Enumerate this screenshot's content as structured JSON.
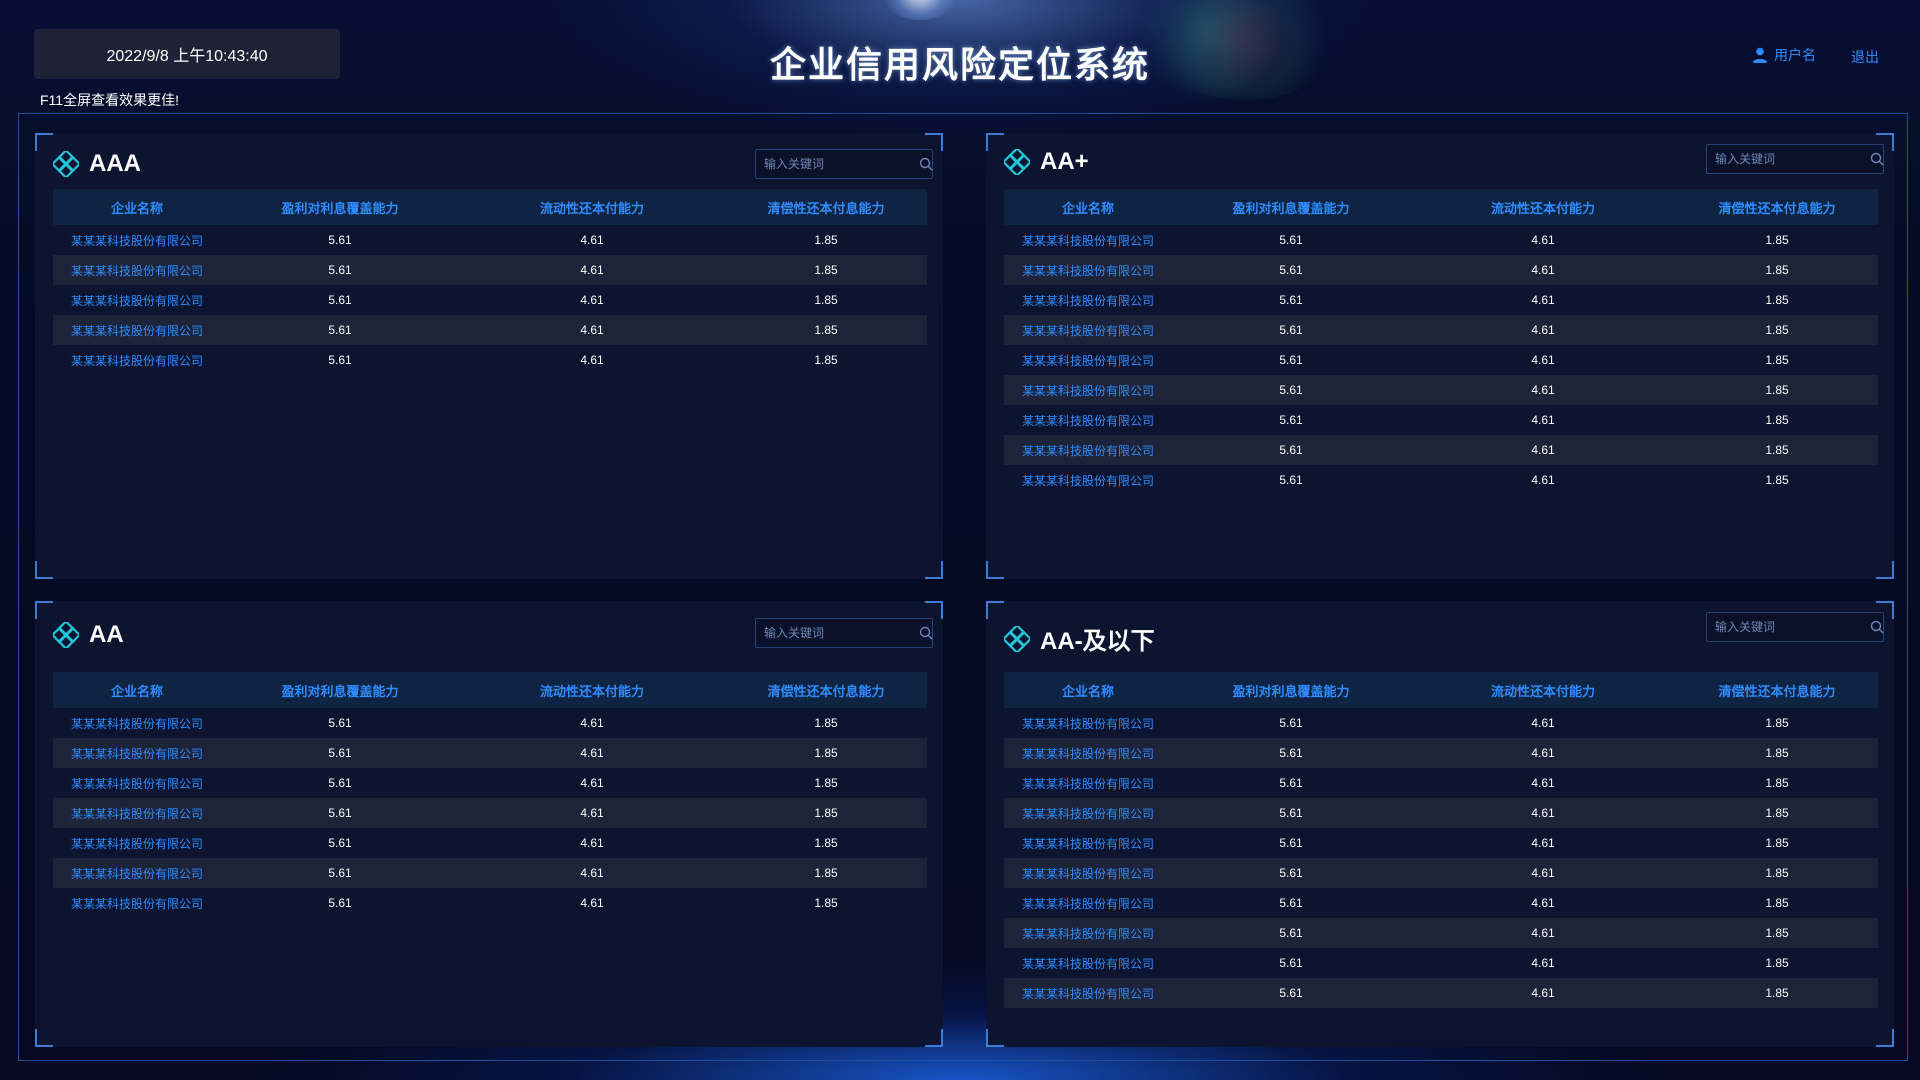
{
  "header": {
    "datetime": "2022/9/8 上午10:43:40",
    "hint": "F11全屏查看效果更佳!",
    "title": "企业信用风险定位系统",
    "username": "用户名",
    "logout": "退出"
  },
  "icons": {
    "panel": "diamond-lattice-icon",
    "search": "search-icon",
    "user": "user-icon"
  },
  "colors": {
    "accent": "#2f8cff",
    "background": "#050b24",
    "panel": "#0c1430"
  },
  "columns": [
    "企业名称",
    "盈利对利息覆盖能力",
    "流动性还本付能力",
    "清偿性还本付息能力"
  ],
  "panels": [
    {
      "title": "AAA",
      "search_placeholder": "输入关键词",
      "rows": [
        [
          "某某某科技股份有限公司",
          "5.61",
          "4.61",
          "1.85"
        ],
        [
          "某某某科技股份有限公司",
          "5.61",
          "4.61",
          "1.85"
        ],
        [
          "某某某科技股份有限公司",
          "5.61",
          "4.61",
          "1.85"
        ],
        [
          "某某某科技股份有限公司",
          "5.61",
          "4.61",
          "1.85"
        ],
        [
          "某某某科技股份有限公司",
          "5.61",
          "4.61",
          "1.85"
        ]
      ]
    },
    {
      "title": "AA+",
      "search_placeholder": "输入关键词",
      "rows": [
        [
          "某某某科技股份有限公司",
          "5.61",
          "4.61",
          "1.85"
        ],
        [
          "某某某科技股份有限公司",
          "5.61",
          "4.61",
          "1.85"
        ],
        [
          "某某某科技股份有限公司",
          "5.61",
          "4.61",
          "1.85"
        ],
        [
          "某某某科技股份有限公司",
          "5.61",
          "4.61",
          "1.85"
        ],
        [
          "某某某科技股份有限公司",
          "5.61",
          "4.61",
          "1.85"
        ],
        [
          "某某某科技股份有限公司",
          "5.61",
          "4.61",
          "1.85"
        ],
        [
          "某某某科技股份有限公司",
          "5.61",
          "4.61",
          "1.85"
        ],
        [
          "某某某科技股份有限公司",
          "5.61",
          "4.61",
          "1.85"
        ],
        [
          "某某某科技股份有限公司",
          "5.61",
          "4.61",
          "1.85"
        ]
      ]
    },
    {
      "title": "AA",
      "search_placeholder": "输入关键词",
      "rows": [
        [
          "某某某科技股份有限公司",
          "5.61",
          "4.61",
          "1.85"
        ],
        [
          "某某某科技股份有限公司",
          "5.61",
          "4.61",
          "1.85"
        ],
        [
          "某某某科技股份有限公司",
          "5.61",
          "4.61",
          "1.85"
        ],
        [
          "某某某科技股份有限公司",
          "5.61",
          "4.61",
          "1.85"
        ],
        [
          "某某某科技股份有限公司",
          "5.61",
          "4.61",
          "1.85"
        ],
        [
          "某某某科技股份有限公司",
          "5.61",
          "4.61",
          "1.85"
        ],
        [
          "某某某科技股份有限公司",
          "5.61",
          "4.61",
          "1.85"
        ]
      ]
    },
    {
      "title": "AA-及以下",
      "search_placeholder": "输入关键词",
      "rows": [
        [
          "某某某科技股份有限公司",
          "5.61",
          "4.61",
          "1.85"
        ],
        [
          "某某某科技股份有限公司",
          "5.61",
          "4.61",
          "1.85"
        ],
        [
          "某某某科技股份有限公司",
          "5.61",
          "4.61",
          "1.85"
        ],
        [
          "某某某科技股份有限公司",
          "5.61",
          "4.61",
          "1.85"
        ],
        [
          "某某某科技股份有限公司",
          "5.61",
          "4.61",
          "1.85"
        ],
        [
          "某某某科技股份有限公司",
          "5.61",
          "4.61",
          "1.85"
        ],
        [
          "某某某科技股份有限公司",
          "5.61",
          "4.61",
          "1.85"
        ],
        [
          "某某某科技股份有限公司",
          "5.61",
          "4.61",
          "1.85"
        ],
        [
          "某某某科技股份有限公司",
          "5.61",
          "4.61",
          "1.85"
        ],
        [
          "某某某科技股份有限公司",
          "5.61",
          "4.61",
          "1.85"
        ]
      ]
    }
  ]
}
